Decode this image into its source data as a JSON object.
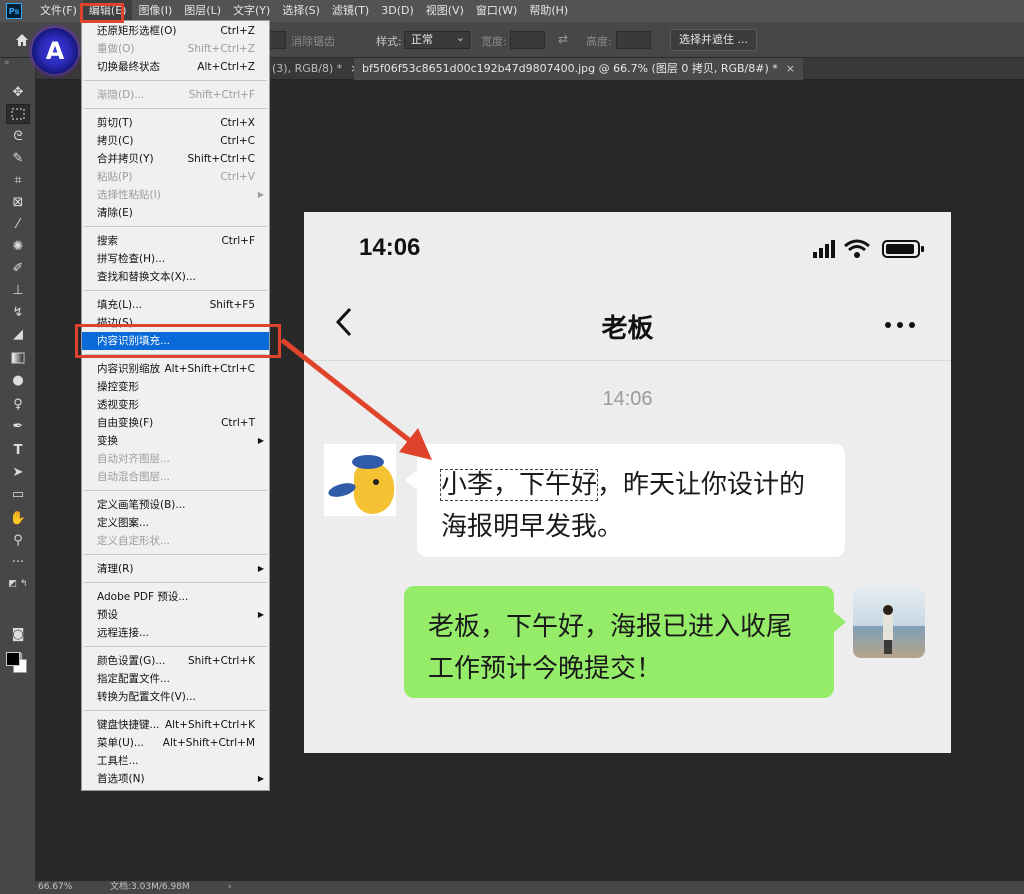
{
  "menubar": {
    "items": [
      "文件(F)",
      "编辑(E)",
      "图像(I)",
      "图层(L)",
      "文字(Y)",
      "选择(S)",
      "滤镜(T)",
      "3D(D)",
      "视图(V)",
      "窗口(W)",
      "帮助(H)"
    ]
  },
  "optionsbar": {
    "antialias_label": "消除锯齿",
    "style_label": "样式:",
    "style_value": "正常",
    "width_label": "宽度:",
    "height_label": "高度:",
    "select_mask_label": "选择并遮住 ..."
  },
  "tabs": [
    {
      "label": "(3), RGB/8) *",
      "close": "×"
    },
    {
      "label": "bf5f06f53c8651d00c192b47d9807400.jpg @ 66.7% (图层 0 拷贝, RGB/8#) *",
      "close": "×"
    }
  ],
  "edit_menu": {
    "items": [
      {
        "label": "还原矩形选框(O)",
        "shortcut": "Ctrl+Z",
        "disabled": false
      },
      {
        "label": "重做(O)",
        "shortcut": "Shift+Ctrl+Z",
        "disabled": true
      },
      {
        "label": "切换最终状态",
        "shortcut": "Alt+Ctrl+Z",
        "disabled": false
      },
      {
        "label": "渐隐(D)...",
        "shortcut": "Shift+Ctrl+F",
        "disabled": true
      },
      {
        "label": "剪切(T)",
        "shortcut": "Ctrl+X",
        "disabled": false
      },
      {
        "label": "拷贝(C)",
        "shortcut": "Ctrl+C",
        "disabled": false
      },
      {
        "label": "合并拷贝(Y)",
        "shortcut": "Shift+Ctrl+C",
        "disabled": false
      },
      {
        "label": "粘贴(P)",
        "shortcut": "Ctrl+V",
        "disabled": true
      },
      {
        "label": "选择性粘贴(I)",
        "shortcut": "",
        "disabled": true
      },
      {
        "label": "清除(E)",
        "shortcut": "",
        "disabled": false
      },
      {
        "label": "搜索",
        "shortcut": "Ctrl+F",
        "disabled": false
      },
      {
        "label": "拼写检查(H)...",
        "shortcut": "",
        "disabled": false
      },
      {
        "label": "查找和替换文本(X)...",
        "shortcut": "",
        "disabled": false
      },
      {
        "label": "填充(L)...",
        "shortcut": "Shift+F5",
        "disabled": false
      },
      {
        "label": "描边(S)...",
        "shortcut": "",
        "disabled": false
      },
      {
        "label": "内容识别填充...",
        "shortcut": "",
        "disabled": false
      },
      {
        "label": "内容识别缩放",
        "shortcut": "Alt+Shift+Ctrl+C",
        "disabled": false
      },
      {
        "label": "操控变形",
        "shortcut": "",
        "disabled": false
      },
      {
        "label": "透视变形",
        "shortcut": "",
        "disabled": false
      },
      {
        "label": "自由变换(F)",
        "shortcut": "Ctrl+T",
        "disabled": false
      },
      {
        "label": "变换",
        "shortcut": "",
        "disabled": false
      },
      {
        "label": "自动对齐图层...",
        "shortcut": "",
        "disabled": true
      },
      {
        "label": "自动混合图层...",
        "shortcut": "",
        "disabled": true
      },
      {
        "label": "定义画笔预设(B)...",
        "shortcut": "",
        "disabled": false
      },
      {
        "label": "定义图案...",
        "shortcut": "",
        "disabled": false
      },
      {
        "label": "定义自定形状...",
        "shortcut": "",
        "disabled": true
      },
      {
        "label": "清理(R)",
        "shortcut": "",
        "disabled": false
      },
      {
        "label": "Adobe PDF 预设...",
        "shortcut": "",
        "disabled": false
      },
      {
        "label": "预设",
        "shortcut": "",
        "disabled": false
      },
      {
        "label": "远程连接...",
        "shortcut": "",
        "disabled": false
      },
      {
        "label": "颜色设置(G)...",
        "shortcut": "Shift+Ctrl+K",
        "disabled": false
      },
      {
        "label": "指定配置文件...",
        "shortcut": "",
        "disabled": false
      },
      {
        "label": "转换为配置文件(V)...",
        "shortcut": "",
        "disabled": false
      },
      {
        "label": "键盘快捷键...",
        "shortcut": "Alt+Shift+Ctrl+K",
        "disabled": false
      },
      {
        "label": "菜单(U)...",
        "shortcut": "Alt+Shift+Ctrl+M",
        "disabled": false
      },
      {
        "label": "工具栏...",
        "shortcut": "",
        "disabled": false
      },
      {
        "label": "首选项(N)",
        "shortcut": "",
        "disabled": false
      }
    ]
  },
  "phone": {
    "status_time": "14:06",
    "nav_title": "老板",
    "chat_time": "14:06",
    "left_message_selected": "小李，下午好",
    "left_message_rest": "，昨天让你设计的海报明早发我。",
    "right_message": "老板，下午好，海报已进入收尾工作预计今晚提交！"
  },
  "statusbar": {
    "zoom": "66.67%",
    "doc_size": "文档:3.03M/6.98M"
  },
  "colors": {
    "accent_red": "#e0432c",
    "menu_highlight": "#0a6ad9",
    "bubble_green": "#95ec69"
  }
}
